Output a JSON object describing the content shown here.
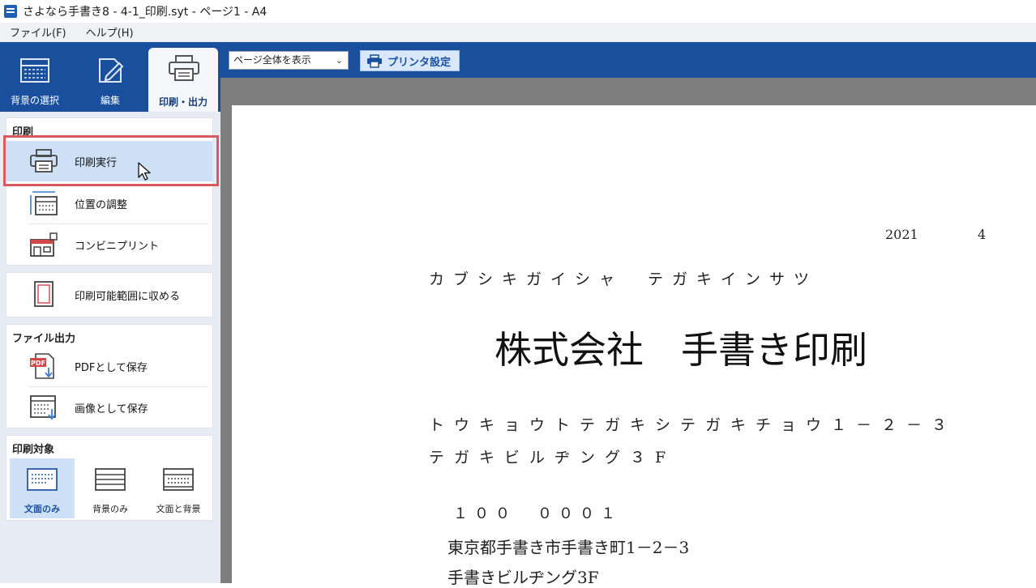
{
  "window": {
    "title": "さよなら手書き8 - 4-1_印刷.syt - ページ1 - A4"
  },
  "menubar": {
    "items": [
      "ファイル(F)",
      "ヘルプ(H)"
    ]
  },
  "nav": {
    "tabs": [
      {
        "label": "背景の選択",
        "icon": "background-grid-icon"
      },
      {
        "label": "編集",
        "icon": "edit-pen-icon"
      },
      {
        "label": "印刷・出力",
        "icon": "printer-icon",
        "active": true
      }
    ]
  },
  "print_section": {
    "title": "印刷",
    "items": [
      {
        "label": "印刷実行",
        "icon": "printer-icon",
        "selected": true
      },
      {
        "label": "位置の調整",
        "icon": "position-adjust-icon"
      },
      {
        "label": "コンビニプリント",
        "icon": "convenience-print-icon"
      }
    ],
    "fit_label": "印刷可能範囲に収める"
  },
  "file_output": {
    "title": "ファイル出力",
    "items": [
      {
        "label": "PDFとして保存",
        "icon": "pdf-save-icon",
        "badge": "PDF"
      },
      {
        "label": "画像として保存",
        "icon": "image-save-icon"
      }
    ]
  },
  "print_target": {
    "title": "印刷対象",
    "options": [
      {
        "label": "文面のみ",
        "icon": "text-only-icon",
        "active": true
      },
      {
        "label": "背景のみ",
        "icon": "background-only-icon"
      },
      {
        "label": "文面と背景",
        "icon": "text-and-background-icon"
      }
    ]
  },
  "toolbar": {
    "zoom_value": "ページ全体を表示",
    "printer_settings_label": "プリンタ設定"
  },
  "document": {
    "date_year": "2021",
    "date_month": "4",
    "company_kana": "カブシキガイシャ　テガキインサツ",
    "company_name": "株式会社　手書き印刷",
    "address_kana_1": "トウキョウトテガキシテガキチョウ１－２－３",
    "address_kana_2": "テガキビルヂング３F",
    "postal_code": "１００　０００１",
    "address_1": "東京都手書き市手書き町1－2－3",
    "address_2": "手書きビルヂング3F"
  },
  "colors": {
    "nav_blue": "#1a4f9e",
    "sidebar_bg": "#e7ebf3",
    "selected_bg": "#cde0f5",
    "highlight_red": "#d85a5e",
    "canvas_gray": "#7e7e7e"
  }
}
